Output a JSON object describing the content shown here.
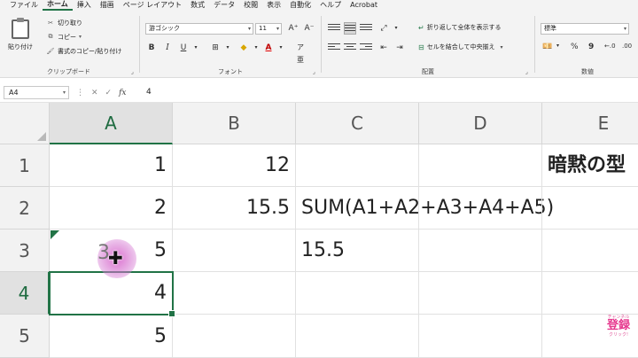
{
  "menu": {
    "tabs": [
      "ファイル",
      "ホーム",
      "挿入",
      "描画",
      "ページ レイアウト",
      "数式",
      "データ",
      "校閲",
      "表示",
      "自動化",
      "ヘルプ",
      "Acrobat"
    ],
    "active": "ホーム"
  },
  "ribbon": {
    "clipboard": {
      "paste": "貼り付け",
      "cut": "切り取り",
      "copy": "コピー",
      "format_painter": "書式のコピー/貼り付け",
      "group_label": "クリップボード"
    },
    "font": {
      "font_name": "游ゴシック",
      "font_size": "11",
      "group_label": "フォント",
      "bold": "B",
      "italic": "I",
      "underline": "U",
      "font_color": "A"
    },
    "alignment": {
      "wrap_text": "折り返して全体を表示する",
      "merge_center": "セルを結合して中央揃え",
      "group_label": "配置"
    },
    "number": {
      "format": "標準",
      "group_label": "数値",
      "percent": "%",
      "comma": "9"
    }
  },
  "formula_bar": {
    "name_box": "A4",
    "fx": "fx",
    "formula": "4"
  },
  "sheet": {
    "columns": [
      "A",
      "B",
      "C",
      "D",
      "E"
    ],
    "rows": [
      "1",
      "2",
      "3",
      "4",
      "5"
    ],
    "selected_column": "A",
    "selected_row": "4",
    "cells": {
      "A1": "1",
      "A2": "2",
      "A3": "5",
      "A4": "4",
      "A5": "5",
      "B1": "12",
      "B2": "15.5",
      "C2": "SUM(A1+A2+A3+A4+A5)",
      "C3": "15.5",
      "E1": "暗黙の型"
    },
    "pointer_overlay_text": "3"
  },
  "badge": {
    "top": "チャンネル",
    "main": "登録",
    "bottom": "クリック!"
  }
}
